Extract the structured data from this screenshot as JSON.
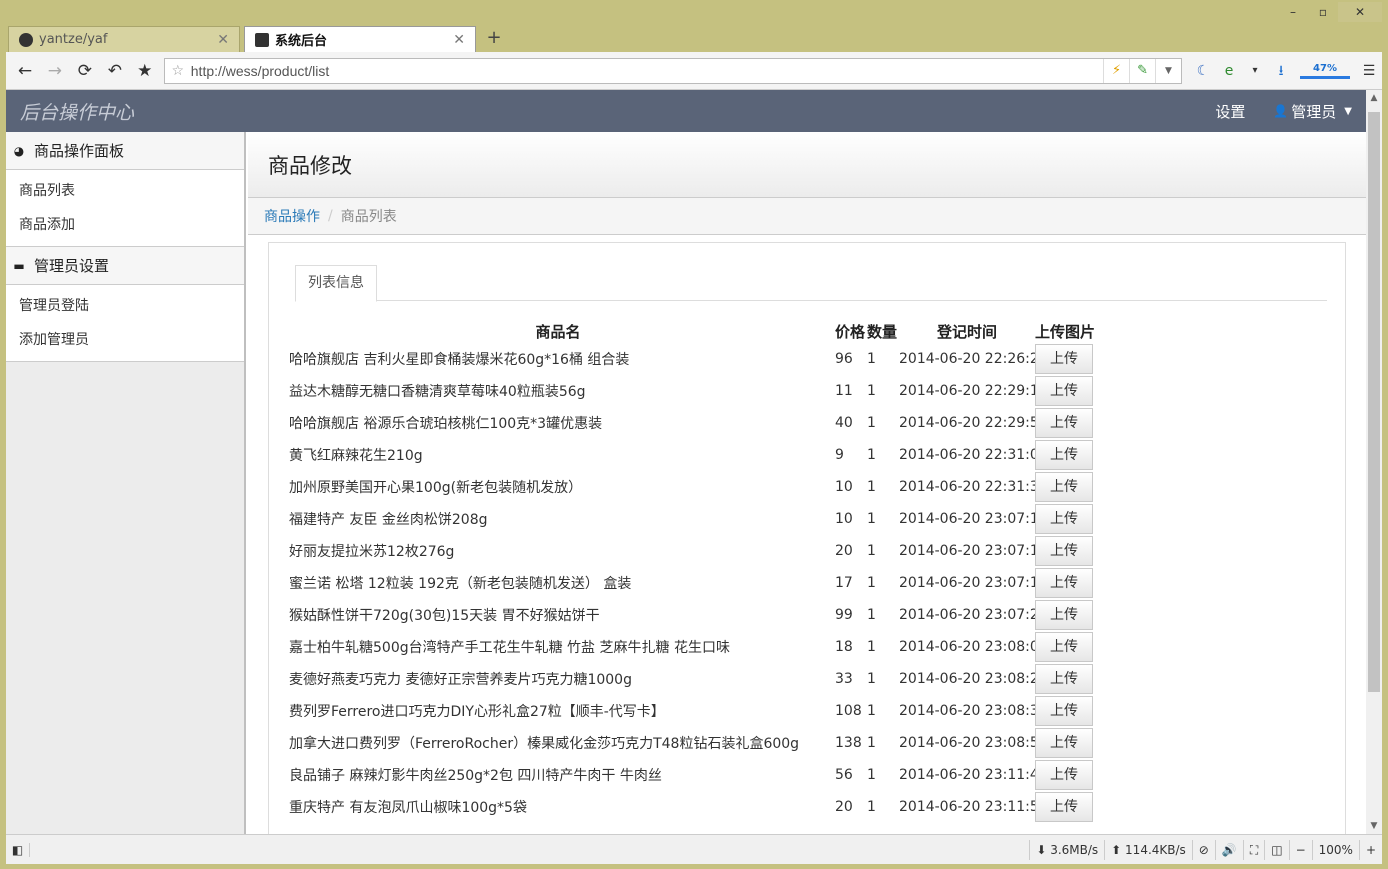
{
  "browser": {
    "tabs": [
      {
        "title": "yantze/yaf",
        "active": false
      },
      {
        "title": "系统后台",
        "active": true
      }
    ],
    "new_tab": "+",
    "url": "http://wess/product/list",
    "zoom_indicator": "47%",
    "status": {
      "down_speed": "3.6MB/s",
      "up_speed": "114.4KB/s",
      "zoom": "100%"
    }
  },
  "navbar": {
    "brand": "后台操作中心",
    "settings": "设置",
    "user": "管理员"
  },
  "sidebar": {
    "sections": [
      {
        "title": "商品操作面板",
        "icon": "dashboard-icon",
        "items": [
          "商品列表",
          "商品添加"
        ]
      },
      {
        "title": "管理员设置",
        "icon": "briefcase-icon",
        "items": [
          "管理员登陆",
          "添加管理员"
        ]
      }
    ]
  },
  "main": {
    "page_title": "商品修改",
    "breadcrumb": {
      "link": "商品操作",
      "current": "商品列表"
    },
    "tab_label": "列表信息",
    "table": {
      "headers": {
        "name": "商品名",
        "price": "价格",
        "qty": "数量",
        "time": "登记时间",
        "upload": "上传图片"
      },
      "upload_label": "上传",
      "rows": [
        {
          "name": "哈哈旗舰店 吉利火星即食桶装爆米花60g*16桶 组合装",
          "price": "96",
          "qty": "1",
          "time": "2014-06-20 22:26:28"
        },
        {
          "name": "益达木糖醇无糖口香糖清爽草莓味40粒瓶装56g",
          "price": "11",
          "qty": "1",
          "time": "2014-06-20 22:29:17"
        },
        {
          "name": "哈哈旗舰店 裕源乐合琥珀核桃仁100克*3罐优惠装",
          "price": "40",
          "qty": "1",
          "time": "2014-06-20 22:29:58"
        },
        {
          "name": "黄飞红麻辣花生210g",
          "price": "9",
          "qty": "1",
          "time": "2014-06-20 22:31:08"
        },
        {
          "name": "加州原野美国开心果100g(新老包装随机发放）",
          "price": "10",
          "qty": "1",
          "time": "2014-06-20 22:31:35"
        },
        {
          "name": "福建特产 友臣 金丝肉松饼208g",
          "price": "10",
          "qty": "1",
          "time": "2014-06-20 23:07:14"
        },
        {
          "name": "好丽友提拉米苏12枚276g",
          "price": "20",
          "qty": "1",
          "time": "2014-06-20 23:07:17"
        },
        {
          "name": "蜜兰诺 松塔 12粒装 192克（新老包装随机发送） 盒装",
          "price": "17",
          "qty": "1",
          "time": "2014-06-20 23:07:19"
        },
        {
          "name": "猴姑酥性饼干720g(30包)15天装 胃不好猴姑饼干",
          "price": "99",
          "qty": "1",
          "time": "2014-06-20 23:07:22"
        },
        {
          "name": "嘉士柏牛轧糖500g台湾特产手工花生牛轧糖 竹盐 芝麻牛扎糖 花生口味",
          "price": "18",
          "qty": "1",
          "time": "2014-06-20 23:08:09"
        },
        {
          "name": "麦德好燕麦巧克力 麦德好正宗营养麦片巧克力糖1000g",
          "price": "33",
          "qty": "1",
          "time": "2014-06-20 23:08:22"
        },
        {
          "name": "费列罗Ferrero进口巧克力DIY心形礼盒27粒【顺丰-代写卡】",
          "price": "108",
          "qty": "1",
          "time": "2014-06-20 23:08:37"
        },
        {
          "name": "加拿大进口费列罗（FerreroRocher）榛果威化金莎巧克力T48粒钻石装礼盒600g",
          "price": "138",
          "qty": "1",
          "time": "2014-06-20 23:08:55"
        },
        {
          "name": "良品铺子 麻辣灯影牛肉丝250g*2包 四川特产牛肉干 牛肉丝",
          "price": "56",
          "qty": "1",
          "time": "2014-06-20 23:11:43"
        },
        {
          "name": "重庆特产 有友泡凤爪山椒味100g*5袋",
          "price": "20",
          "qty": "1",
          "time": "2014-06-20 23:11:54"
        }
      ]
    }
  },
  "colors": {
    "navbar_bg": "#5a6478",
    "link": "#2a7ab8",
    "frame": "#c5c180"
  }
}
